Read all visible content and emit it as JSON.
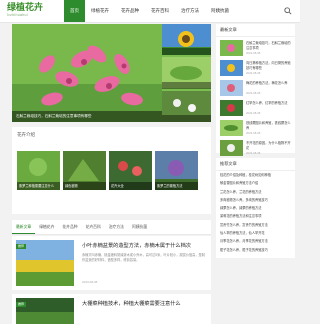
{
  "header": {
    "logo_main": "绿植花卉",
    "logo_sub": "lvzhihuahui",
    "nav": [
      "首页",
      "绿植花卉",
      "花卉品种",
      "花卉百科",
      "治疗方法",
      "阿姨抗菌"
    ],
    "active_nav_index": 0
  },
  "hero": {
    "main_caption": "石斛兰栽培技巧，石斛兰栽培的注意事项有哪些",
    "side_tiles": [
      "",
      "",
      ""
    ]
  },
  "section": {
    "title": "花卉介绍",
    "thumbs": [
      {
        "caption": "紫罗兰种植需要注意什么"
      },
      {
        "caption": "绿色植物"
      },
      {
        "caption": "花卉大全"
      },
      {
        "caption": "紫罗兰的繁殖方法"
      }
    ]
  },
  "tabs": [
    "最新文章",
    "绿植花卉",
    "花卉品种",
    "花卉百科",
    "治疗方法",
    "阿姨抗菌"
  ],
  "articles": [
    {
      "tag": "推荐",
      "title": "小叶赤楠盆景的造型方法，赤楠木属于什么档次",
      "desc": "赤楠又叫赤楠、桃金娘科常绿灌木或小乔木，高可达5米，叶片较小，观赏价值高，是制作盆景的好材料，造型多样，修剪容易。",
      "meta": "2023-08-08"
    },
    {
      "tag": "推荐",
      "title": "大棚菜种植技术，种植大棚菜需要注意什么",
      "desc": "",
      "meta": ""
    }
  ],
  "sidebar": {
    "box1": {
      "title": "最新文章",
      "items": [
        {
          "text": "石斛兰栽培技巧，石斛兰栽培的注意事项",
          "date": "2023-08-08"
        },
        {
          "text": "向日葵种植方法，向日葵的养殖技巧有哪些",
          "date": "2023-08-08"
        },
        {
          "text": "梅花的养殖方法，梅花怎么养",
          "date": "2023-08-08"
        },
        {
          "text": "红掌怎么养，红掌的养殖方法",
          "date": "2023-08-08"
        },
        {
          "text": "铁线蕨图片和养殖，铁线蕨怎么养",
          "date": "2023-08-08"
        },
        {
          "text": "不开花的原因，为什么植物不开花",
          "date": "2023-08-08"
        }
      ]
    },
    "box2": {
      "title": "推荐文章",
      "lines": [
        "桂花的介绍及种植，桂花树如何种植",
        "郁金香图片和养殖方法介绍",
        "兰花怎么养，兰花的养殖方法",
        "多肉植物怎么养，多肉的养殖技巧",
        "绿萝怎么养，绿萝的养殖方法",
        "茉莉花的养殖方法和注意事项",
        "富贵竹怎么养，富贵竹的养殖方法",
        "仙人掌的养殖方法，仙人掌开花",
        "月季花怎么养，月季花的养殖方法",
        "栀子花怎么养，栀子花的养殖技巧"
      ]
    }
  },
  "colors": {
    "brand": "#2e8b2e",
    "logo": "#3a8f2b"
  }
}
